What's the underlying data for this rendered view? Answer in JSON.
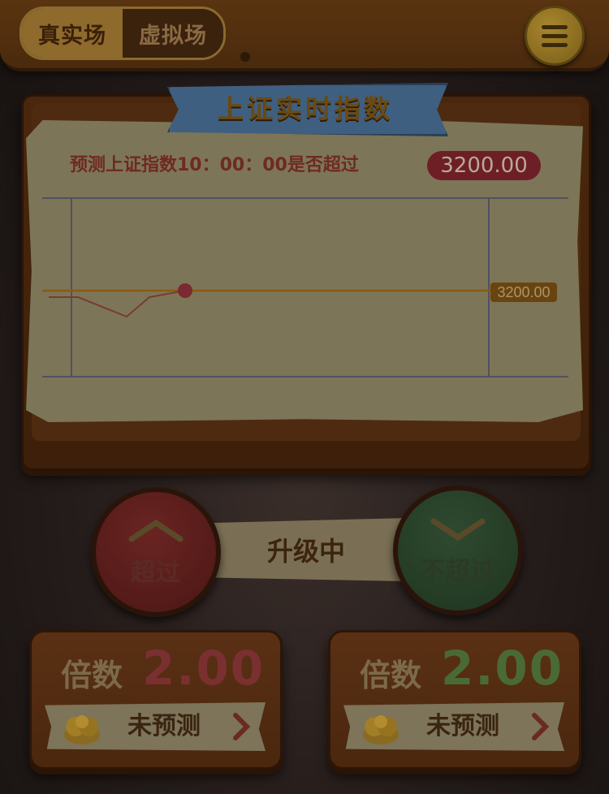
{
  "header": {
    "mode_real": "真实场",
    "mode_virtual": "虚拟场",
    "menu_icon": "menu-list-icon"
  },
  "board": {
    "title": "上证实时指数",
    "question": "预测上证指数10：00：00是否超过",
    "target_value": "3200.00",
    "threshold_label": "3200.00"
  },
  "chart_data": {
    "type": "line",
    "series": [
      {
        "values": [
          3199,
          3199,
          3196,
          3199,
          3200
        ]
      }
    ],
    "threshold": 3200,
    "grid": "outer box only",
    "colors": {
      "line": "#7a3a30",
      "threshold": "#8a5a14",
      "frame": "#4f5260"
    }
  },
  "controls": {
    "up_label": "超过",
    "down_label": "不超过",
    "status": "升级中"
  },
  "bets": [
    {
      "multiplier_label": "倍数",
      "multiplier": "2.00",
      "status": "未预测"
    },
    {
      "multiplier_label": "倍数",
      "multiplier": "2.00",
      "status": "未预测"
    }
  ],
  "colors": {
    "up": "#4a1714",
    "down": "#1f341f",
    "accent": "#8e6a2c"
  }
}
